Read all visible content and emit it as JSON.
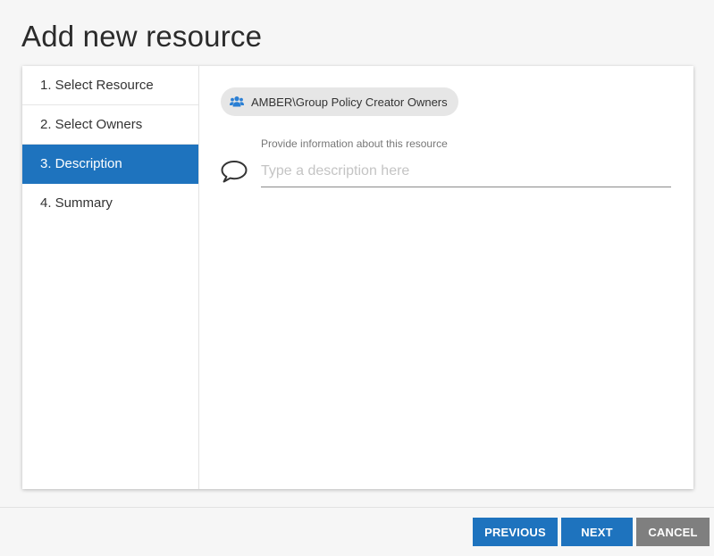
{
  "page": {
    "title": "Add new resource"
  },
  "steps": [
    {
      "label": "1. Select Resource",
      "active": false
    },
    {
      "label": "2. Select Owners",
      "active": false
    },
    {
      "label": "3. Description",
      "active": true
    },
    {
      "label": "4. Summary",
      "active": false
    }
  ],
  "resource_chip": {
    "icon": "group-icon",
    "label": "AMBER\\Group Policy Creator Owners"
  },
  "description": {
    "icon": "speech-bubble-icon",
    "label": "Provide information about this resource",
    "value": "",
    "placeholder": "Type a description here"
  },
  "footer": {
    "previous_label": "PREVIOUS",
    "next_label": "NEXT",
    "cancel_label": "CANCEL"
  },
  "colors": {
    "accent": "#1e73be",
    "cancel": "#7f7f7f",
    "chip_bg": "#e6e6e6",
    "group_icon": "#2a7fd4"
  }
}
